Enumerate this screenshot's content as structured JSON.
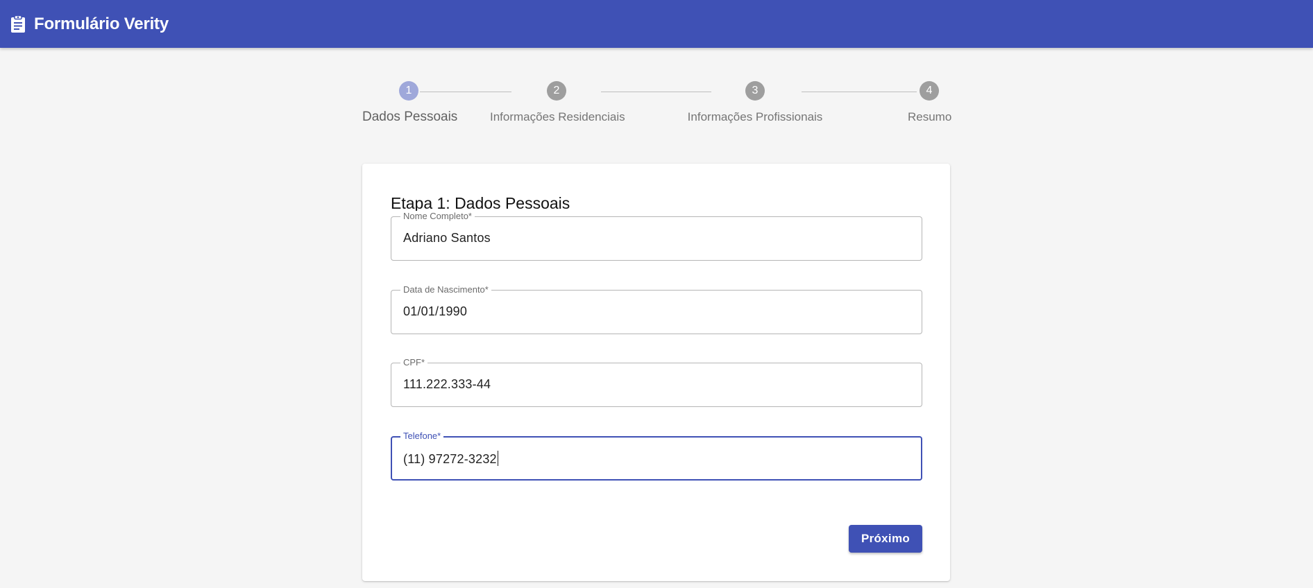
{
  "app": {
    "title": "Formulário Verity",
    "logo_icon": "clipboard-icon",
    "primary_color": "#3f51b5"
  },
  "stepper": {
    "active_step": 1,
    "steps": [
      {
        "number": "1",
        "label": "Dados Pessoais"
      },
      {
        "number": "2",
        "label": "Informações Residenciais"
      },
      {
        "number": "3",
        "label": "Informações Profissionais"
      },
      {
        "number": "4",
        "label": "Resumo"
      }
    ]
  },
  "form": {
    "title": "Etapa 1: Dados Pessoais",
    "fields": [
      {
        "label": "Nome Completo*",
        "value": "Adriano Santos"
      },
      {
        "label": "Data de Nascimento*",
        "value": "01/01/1990"
      },
      {
        "label": "CPF*",
        "value": "111.222.333-44"
      },
      {
        "label": "Telefone*",
        "value": "(11) 97272-3232",
        "focused": true
      }
    ],
    "next_label": "Próximo"
  }
}
